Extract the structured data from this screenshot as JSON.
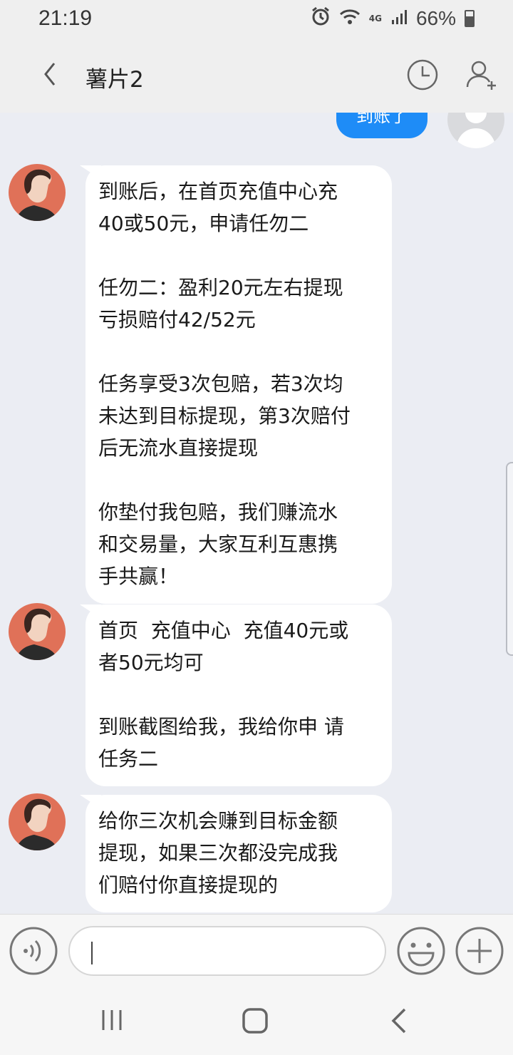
{
  "status_bar": {
    "time": "21:19",
    "network": "4G",
    "battery": "66%"
  },
  "header": {
    "title": "薯片2"
  },
  "chat": {
    "sent_partial": "到账了",
    "messages": [
      {
        "text": "到账后，在首页充值中心充\n40或50元，申请任勿二\n\n任勿二：盈利20元左右提现\n亏损赔付42/52元\n\n任务享受3次包赔，若3次均\n未达到目标提现，第3次赔付\n后无流水直接提现\n\n你垫付我包赔，我们赚流水\n和交易量，大家互利互惠携\n手共赢！"
      },
      {
        "text": "首页  充值中心  充值40元或\n者50元均可\n\n到账截图给我，我给你申 请\n任务二"
      },
      {
        "text": "给你三次机会赚到目标金额\n提现，如果三次都没完成我\n们赔付你直接提现的"
      }
    ]
  },
  "input_bar": {
    "value": ""
  },
  "colors": {
    "sent_bubble": "#1e8cf7",
    "chat_background": "#ebedf3",
    "avatar_bg": "#e07158"
  }
}
